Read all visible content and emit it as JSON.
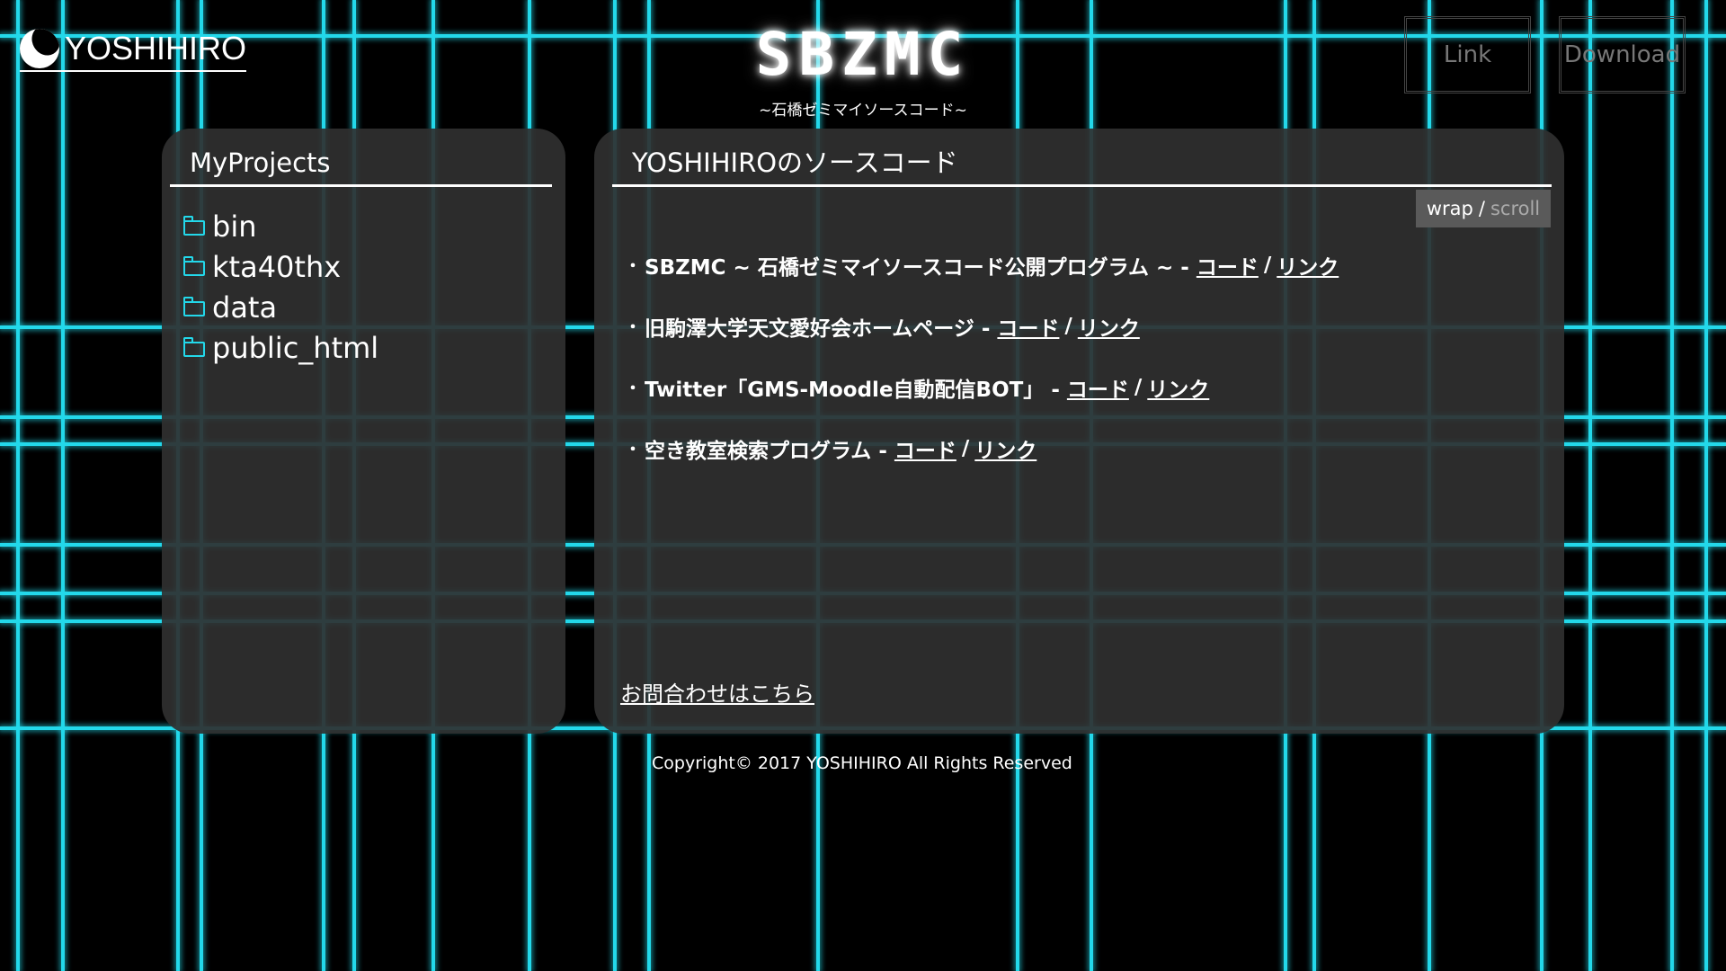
{
  "theme": {
    "grid_color": "#23d8ea",
    "panel_color": "#303030",
    "background": "#000000"
  },
  "header": {
    "brand": "YOSHIHIRO",
    "title": "SBZMC",
    "subtitle": "~石橋ゼミマイソースコード~",
    "link_button": "Link",
    "download_button": "Download"
  },
  "sidebar": {
    "heading": "MyProjects",
    "folders": [
      "bin",
      "kta40thx",
      "data",
      "public_html"
    ],
    "folder_icon": "folder-icon"
  },
  "main": {
    "heading": "YOSHIHIROのソースコード",
    "wrap_label": "wrap",
    "wrap_sep": "/",
    "scroll_label": "scroll",
    "projects": [
      {
        "title": "SBZMC ~ 石橋ゼミマイソースコード公開プログラム ~ -",
        "code": "コード",
        "sep": "/",
        "link": "リンク"
      },
      {
        "title": "旧駒澤大学天文愛好会ホームページ -",
        "code": "コード",
        "sep": "/",
        "link": "リンク"
      },
      {
        "title": "Twitter「GMS-Moodle自動配信BOT」 -",
        "code": "コード",
        "sep": "/",
        "link": "リンク"
      },
      {
        "title": "空き教室検索プログラム -",
        "code": "コード",
        "sep": "/",
        "link": "リンク"
      }
    ],
    "contact": "お問合わせはこちら"
  },
  "footer": {
    "copyright": "Copyright© 2017 YOSHIHIRO All Rights Reserved"
  }
}
